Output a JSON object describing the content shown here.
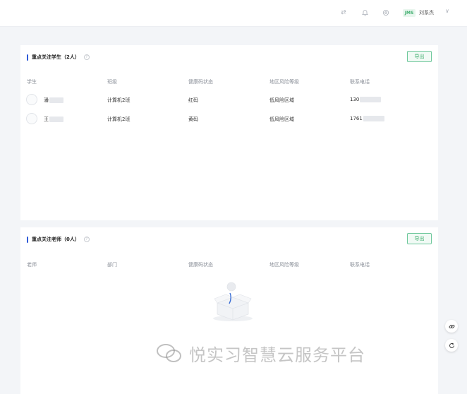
{
  "topbar": {
    "icons": [
      "swap-icon",
      "bell-icon",
      "settings-icon"
    ],
    "user_badge": "JMS",
    "user_name": "刘系杰",
    "chevron": "∨"
  },
  "students_card": {
    "title": "重点关注学生（2人）",
    "export_label": "导出",
    "columns": [
      "学生",
      "班级",
      "健康码状态",
      "地区风险等级",
      "联系电话"
    ],
    "rows": [
      {
        "name": "潘",
        "class": "计算机2班",
        "health_code": "红码",
        "risk": "低风险区域",
        "phone": "130"
      },
      {
        "name": "王",
        "class": "计算机2班",
        "health_code": "黄码",
        "risk": "低风险区域",
        "phone": "1761"
      }
    ]
  },
  "teachers_card": {
    "title": "重点关注老师（0人）",
    "export_label": "导出",
    "columns": [
      "老师",
      "部门",
      "健康码状态",
      "地区风险等级",
      "联系电话"
    ]
  },
  "watermark": {
    "text": "悦实习智慧云服务平台"
  },
  "side_buttons": [
    "link-icon",
    "refresh-icon"
  ]
}
